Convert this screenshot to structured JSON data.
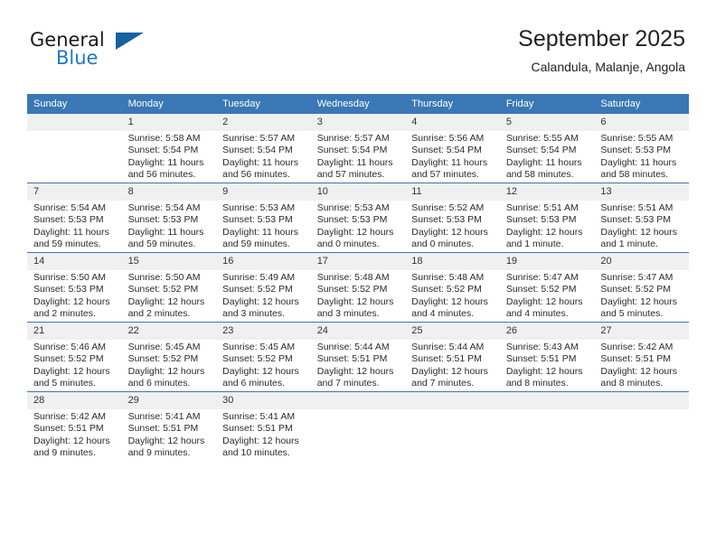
{
  "brand": {
    "name_part1": "General",
    "name_part2": "Blue",
    "flag_icon": "triangle-flag-icon"
  },
  "header": {
    "title": "September 2025",
    "location": "Calandula, Malanje, Angola"
  },
  "calendar": {
    "weekday_headers": [
      "Sunday",
      "Monday",
      "Tuesday",
      "Wednesday",
      "Thursday",
      "Friday",
      "Saturday"
    ],
    "accent_color": "#3a77b5",
    "datenum_band_color": "#f0f0f0",
    "weeks": [
      [
        {
          "day": "",
          "sunrise": "",
          "sunset": "",
          "daylight_line1": "",
          "daylight_line2": "",
          "empty": true
        },
        {
          "day": "1",
          "sunrise": "Sunrise: 5:58 AM",
          "sunset": "Sunset: 5:54 PM",
          "daylight_line1": "Daylight: 11 hours",
          "daylight_line2": "and 56 minutes.",
          "empty": false
        },
        {
          "day": "2",
          "sunrise": "Sunrise: 5:57 AM",
          "sunset": "Sunset: 5:54 PM",
          "daylight_line1": "Daylight: 11 hours",
          "daylight_line2": "and 56 minutes.",
          "empty": false
        },
        {
          "day": "3",
          "sunrise": "Sunrise: 5:57 AM",
          "sunset": "Sunset: 5:54 PM",
          "daylight_line1": "Daylight: 11 hours",
          "daylight_line2": "and 57 minutes.",
          "empty": false
        },
        {
          "day": "4",
          "sunrise": "Sunrise: 5:56 AM",
          "sunset": "Sunset: 5:54 PM",
          "daylight_line1": "Daylight: 11 hours",
          "daylight_line2": "and 57 minutes.",
          "empty": false
        },
        {
          "day": "5",
          "sunrise": "Sunrise: 5:55 AM",
          "sunset": "Sunset: 5:54 PM",
          "daylight_line1": "Daylight: 11 hours",
          "daylight_line2": "and 58 minutes.",
          "empty": false
        },
        {
          "day": "6",
          "sunrise": "Sunrise: 5:55 AM",
          "sunset": "Sunset: 5:53 PM",
          "daylight_line1": "Daylight: 11 hours",
          "daylight_line2": "and 58 minutes.",
          "empty": false
        }
      ],
      [
        {
          "day": "7",
          "sunrise": "Sunrise: 5:54 AM",
          "sunset": "Sunset: 5:53 PM",
          "daylight_line1": "Daylight: 11 hours",
          "daylight_line2": "and 59 minutes.",
          "empty": false
        },
        {
          "day": "8",
          "sunrise": "Sunrise: 5:54 AM",
          "sunset": "Sunset: 5:53 PM",
          "daylight_line1": "Daylight: 11 hours",
          "daylight_line2": "and 59 minutes.",
          "empty": false
        },
        {
          "day": "9",
          "sunrise": "Sunrise: 5:53 AM",
          "sunset": "Sunset: 5:53 PM",
          "daylight_line1": "Daylight: 11 hours",
          "daylight_line2": "and 59 minutes.",
          "empty": false
        },
        {
          "day": "10",
          "sunrise": "Sunrise: 5:53 AM",
          "sunset": "Sunset: 5:53 PM",
          "daylight_line1": "Daylight: 12 hours",
          "daylight_line2": "and 0 minutes.",
          "empty": false
        },
        {
          "day": "11",
          "sunrise": "Sunrise: 5:52 AM",
          "sunset": "Sunset: 5:53 PM",
          "daylight_line1": "Daylight: 12 hours",
          "daylight_line2": "and 0 minutes.",
          "empty": false
        },
        {
          "day": "12",
          "sunrise": "Sunrise: 5:51 AM",
          "sunset": "Sunset: 5:53 PM",
          "daylight_line1": "Daylight: 12 hours",
          "daylight_line2": "and 1 minute.",
          "empty": false
        },
        {
          "day": "13",
          "sunrise": "Sunrise: 5:51 AM",
          "sunset": "Sunset: 5:53 PM",
          "daylight_line1": "Daylight: 12 hours",
          "daylight_line2": "and 1 minute.",
          "empty": false
        }
      ],
      [
        {
          "day": "14",
          "sunrise": "Sunrise: 5:50 AM",
          "sunset": "Sunset: 5:53 PM",
          "daylight_line1": "Daylight: 12 hours",
          "daylight_line2": "and 2 minutes.",
          "empty": false
        },
        {
          "day": "15",
          "sunrise": "Sunrise: 5:50 AM",
          "sunset": "Sunset: 5:52 PM",
          "daylight_line1": "Daylight: 12 hours",
          "daylight_line2": "and 2 minutes.",
          "empty": false
        },
        {
          "day": "16",
          "sunrise": "Sunrise: 5:49 AM",
          "sunset": "Sunset: 5:52 PM",
          "daylight_line1": "Daylight: 12 hours",
          "daylight_line2": "and 3 minutes.",
          "empty": false
        },
        {
          "day": "17",
          "sunrise": "Sunrise: 5:48 AM",
          "sunset": "Sunset: 5:52 PM",
          "daylight_line1": "Daylight: 12 hours",
          "daylight_line2": "and 3 minutes.",
          "empty": false
        },
        {
          "day": "18",
          "sunrise": "Sunrise: 5:48 AM",
          "sunset": "Sunset: 5:52 PM",
          "daylight_line1": "Daylight: 12 hours",
          "daylight_line2": "and 4 minutes.",
          "empty": false
        },
        {
          "day": "19",
          "sunrise": "Sunrise: 5:47 AM",
          "sunset": "Sunset: 5:52 PM",
          "daylight_line1": "Daylight: 12 hours",
          "daylight_line2": "and 4 minutes.",
          "empty": false
        },
        {
          "day": "20",
          "sunrise": "Sunrise: 5:47 AM",
          "sunset": "Sunset: 5:52 PM",
          "daylight_line1": "Daylight: 12 hours",
          "daylight_line2": "and 5 minutes.",
          "empty": false
        }
      ],
      [
        {
          "day": "21",
          "sunrise": "Sunrise: 5:46 AM",
          "sunset": "Sunset: 5:52 PM",
          "daylight_line1": "Daylight: 12 hours",
          "daylight_line2": "and 5 minutes.",
          "empty": false
        },
        {
          "day": "22",
          "sunrise": "Sunrise: 5:45 AM",
          "sunset": "Sunset: 5:52 PM",
          "daylight_line1": "Daylight: 12 hours",
          "daylight_line2": "and 6 minutes.",
          "empty": false
        },
        {
          "day": "23",
          "sunrise": "Sunrise: 5:45 AM",
          "sunset": "Sunset: 5:52 PM",
          "daylight_line1": "Daylight: 12 hours",
          "daylight_line2": "and 6 minutes.",
          "empty": false
        },
        {
          "day": "24",
          "sunrise": "Sunrise: 5:44 AM",
          "sunset": "Sunset: 5:51 PM",
          "daylight_line1": "Daylight: 12 hours",
          "daylight_line2": "and 7 minutes.",
          "empty": false
        },
        {
          "day": "25",
          "sunrise": "Sunrise: 5:44 AM",
          "sunset": "Sunset: 5:51 PM",
          "daylight_line1": "Daylight: 12 hours",
          "daylight_line2": "and 7 minutes.",
          "empty": false
        },
        {
          "day": "26",
          "sunrise": "Sunrise: 5:43 AM",
          "sunset": "Sunset: 5:51 PM",
          "daylight_line1": "Daylight: 12 hours",
          "daylight_line2": "and 8 minutes.",
          "empty": false
        },
        {
          "day": "27",
          "sunrise": "Sunrise: 5:42 AM",
          "sunset": "Sunset: 5:51 PM",
          "daylight_line1": "Daylight: 12 hours",
          "daylight_line2": "and 8 minutes.",
          "empty": false
        }
      ],
      [
        {
          "day": "28",
          "sunrise": "Sunrise: 5:42 AM",
          "sunset": "Sunset: 5:51 PM",
          "daylight_line1": "Daylight: 12 hours",
          "daylight_line2": "and 9 minutes.",
          "empty": false
        },
        {
          "day": "29",
          "sunrise": "Sunrise: 5:41 AM",
          "sunset": "Sunset: 5:51 PM",
          "daylight_line1": "Daylight: 12 hours",
          "daylight_line2": "and 9 minutes.",
          "empty": false
        },
        {
          "day": "30",
          "sunrise": "Sunrise: 5:41 AM",
          "sunset": "Sunset: 5:51 PM",
          "daylight_line1": "Daylight: 12 hours",
          "daylight_line2": "and 10 minutes.",
          "empty": false
        },
        {
          "day": "",
          "sunrise": "",
          "sunset": "",
          "daylight_line1": "",
          "daylight_line2": "",
          "empty": true
        },
        {
          "day": "",
          "sunrise": "",
          "sunset": "",
          "daylight_line1": "",
          "daylight_line2": "",
          "empty": true
        },
        {
          "day": "",
          "sunrise": "",
          "sunset": "",
          "daylight_line1": "",
          "daylight_line2": "",
          "empty": true
        },
        {
          "day": "",
          "sunrise": "",
          "sunset": "",
          "daylight_line1": "",
          "daylight_line2": "",
          "empty": true
        }
      ]
    ]
  }
}
